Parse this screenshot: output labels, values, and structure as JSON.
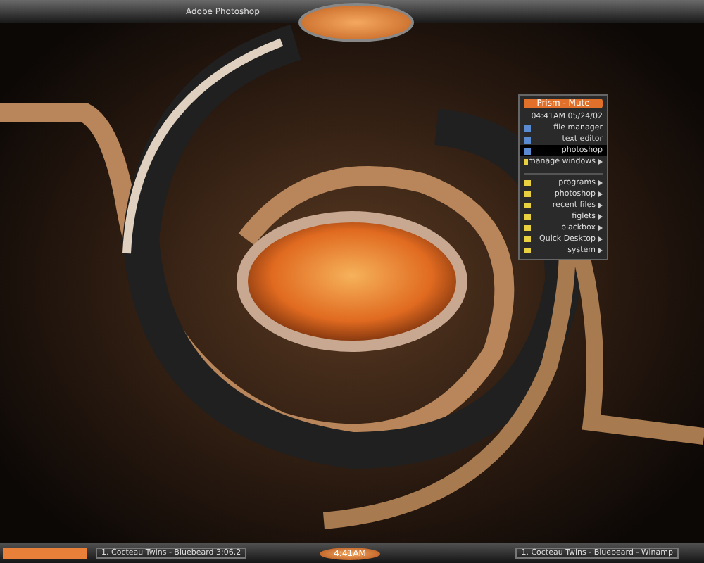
{
  "top_bar": {
    "task_title": "Adobe Photoshop"
  },
  "menu": {
    "title": "Prism - Mute",
    "items": [
      {
        "kind": "info",
        "label": "04:41AM 05/24/02"
      },
      {
        "kind": "app",
        "label": "file manager"
      },
      {
        "kind": "app",
        "label": "text editor"
      },
      {
        "kind": "app",
        "label": "photoshop",
        "selected": true
      },
      {
        "kind": "submenu",
        "label": "manage windows"
      },
      {
        "kind": "separator"
      },
      {
        "kind": "submenu",
        "label": "programs"
      },
      {
        "kind": "submenu",
        "label": "photoshop"
      },
      {
        "kind": "submenu",
        "label": "recent files"
      },
      {
        "kind": "submenu",
        "label": "figlets"
      },
      {
        "kind": "submenu",
        "label": "blackbox"
      },
      {
        "kind": "submenu",
        "label": "Quick Desktop"
      },
      {
        "kind": "submenu",
        "label": "system"
      }
    ]
  },
  "bottom_bar": {
    "progress": {
      "level": 1
    },
    "left_task": "1. Cocteau Twins - Bluebeard 3:06.2",
    "clock": "4:41AM",
    "right_task": "1. Cocteau Twins - Bluebeard - Winamp"
  }
}
